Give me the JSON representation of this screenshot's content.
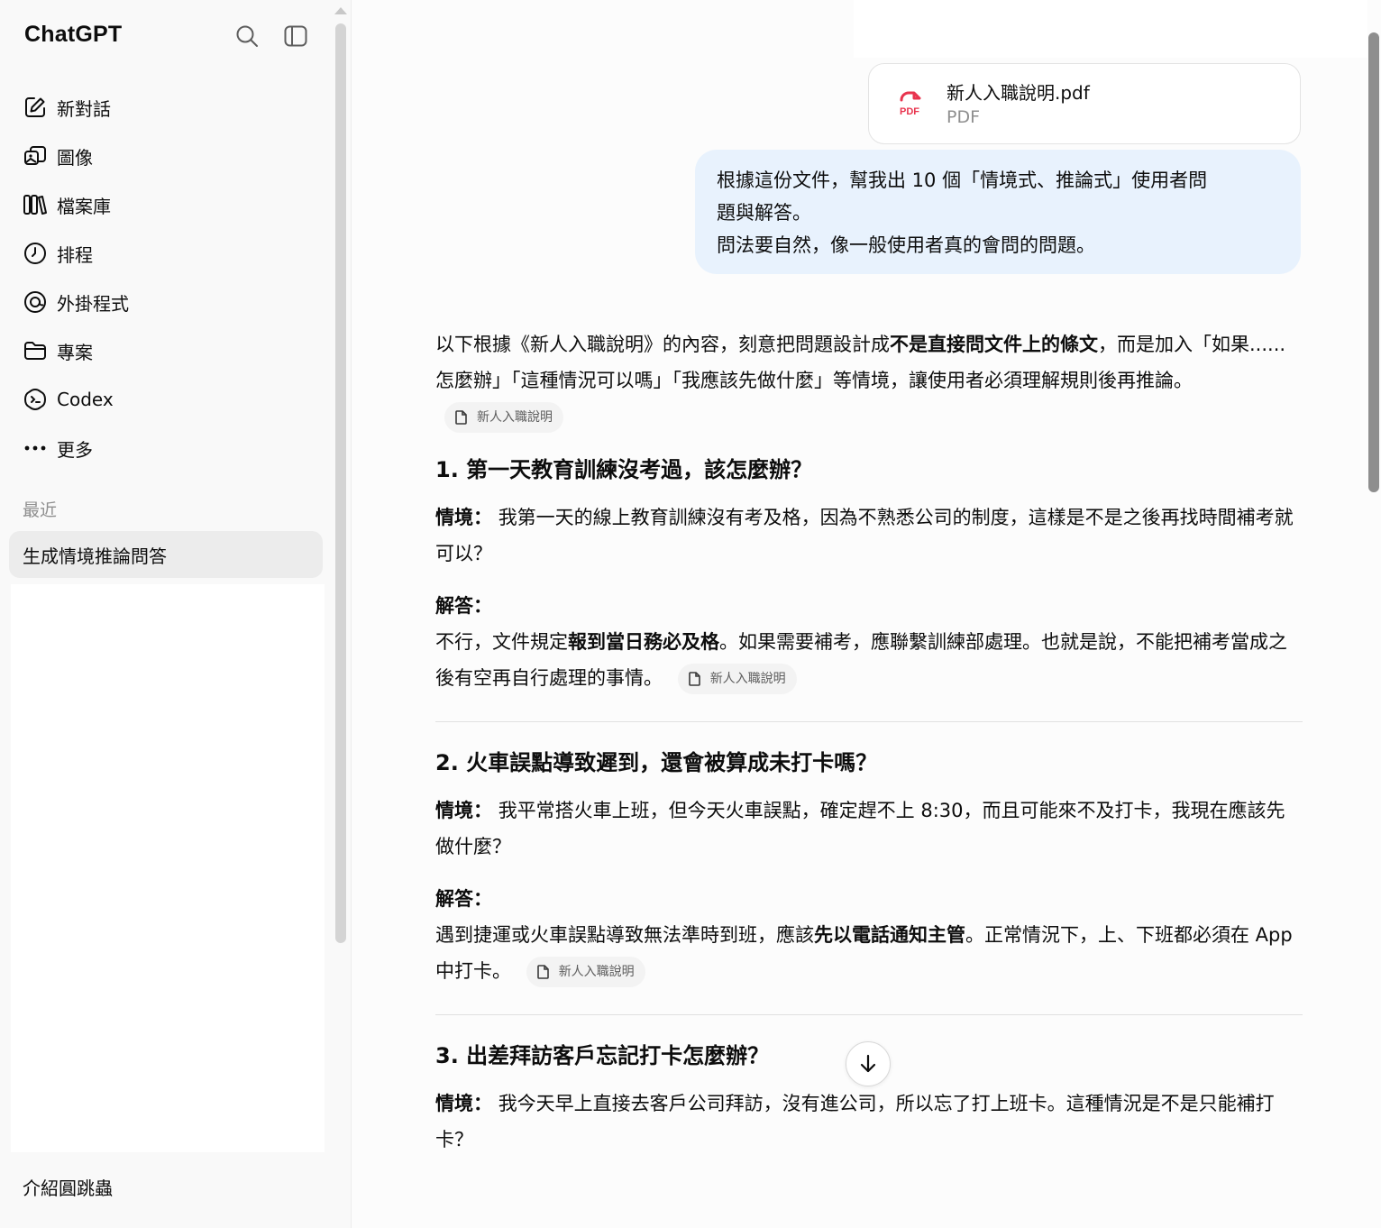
{
  "sidebar": {
    "brand": "ChatGPT",
    "icons": {
      "search": "search-icon",
      "toggle": "sidebar-toggle-icon"
    },
    "items": [
      {
        "label": "新對話",
        "icon": "edit-icon"
      },
      {
        "label": "圖像",
        "icon": "images-icon"
      },
      {
        "label": "檔案庫",
        "icon": "library-icon"
      },
      {
        "label": "排程",
        "icon": "clock-icon"
      },
      {
        "label": "外掛程式",
        "icon": "plugins-icon"
      },
      {
        "label": "專案",
        "icon": "folder-icon"
      },
      {
        "label": "Codex",
        "icon": "codex-icon"
      },
      {
        "label": "更多",
        "icon": "more-icon"
      }
    ],
    "recent_label": "最近",
    "recent_chats": [
      "生成情境推論問答"
    ],
    "bottom_item": "介紹圓跳蟲"
  },
  "attachment": {
    "name": "新人入職說明.pdf",
    "type": "PDF",
    "icon_label": "PDF"
  },
  "user_message": {
    "lines": [
      "根據這份文件，幫我出 10 個「情境式、推論式」使用者問",
      "題與解答。",
      "問法要自然，像一般使用者真的會問的問題。"
    ]
  },
  "assistant": {
    "intro_before": "以下根據《新人入職說明》的內容，刻意把問題設計成",
    "intro_bold": "不是直接問文件上的條文",
    "intro_after": "，而是加入「如果......怎麼辦」「這種情況可以嗎」「我應該先做什麼」等情境，讓使用者必須理解規則後再推論。",
    "citation": "新人入職說明",
    "scenario_label": "情境：",
    "answer_label": "解答：",
    "questions": [
      {
        "title": "1. 第一天教育訓練沒考過，該怎麼辦？",
        "scenario": "我第一天的線上教育訓練沒有考及格，因為不熟悉公司的制度，這樣是不是之後再找時間補考就可以？",
        "answer_before": "不行，文件規定",
        "answer_bold": "報到當日務必及格",
        "answer_after": "。如果需要補考，應聯繫訓練部處理。也就是說，不能把補考當成之後有空再自行處理的事情。"
      },
      {
        "title": "2. 火車誤點導致遲到，還會被算成未打卡嗎？",
        "scenario": "我平常搭火車上班，但今天火車誤點，確定趕不上 8:30，而且可能來不及打卡，我現在應該先做什麼？",
        "answer_before": "遇到捷運或火車誤點導致無法準時到班，應該",
        "answer_bold": "先以電話通知主管",
        "answer_after": "。正常情況下，上、下班都必須在 App 中打卡。"
      },
      {
        "title": "3. 出差拜訪客戶忘記打卡怎麼辦？",
        "scenario": "我今天早上直接去客戶公司拜訪，沒有進公司，所以忘了打上班卡。這種情況是不是只能補打卡？"
      }
    ]
  }
}
